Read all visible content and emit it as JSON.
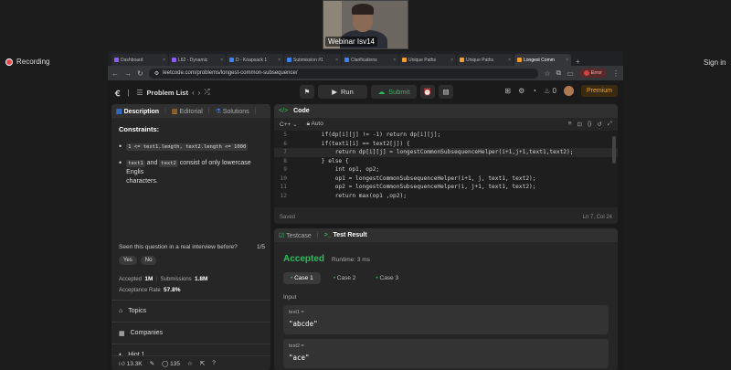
{
  "meeting": {
    "webcam_label": "Webinar Isv14",
    "recording_label": "Recording",
    "signin_label": "Sign in"
  },
  "browser": {
    "tabs": [
      {
        "title": "Dashboard",
        "favicon": "purple"
      },
      {
        "title": "L62 - Dynamic",
        "favicon": "purple"
      },
      {
        "title": "D - Knapsack 1",
        "favicon": "blue"
      },
      {
        "title": "Submission #1",
        "favicon": "blue"
      },
      {
        "title": "Clarifications",
        "favicon": "blue"
      },
      {
        "title": "Unique Paths",
        "favicon": "orange"
      },
      {
        "title": "Unique Paths",
        "favicon": "orange"
      },
      {
        "title": "Longest Comm",
        "favicon": "orange"
      }
    ],
    "url": "leetcode.com/problems/longest-common-subsequence/",
    "error_label": "Error"
  },
  "header": {
    "problem_list": "Problem List",
    "run": "Run",
    "submit": "Submit",
    "streak": "0",
    "premium": "Premium"
  },
  "left_panel": {
    "tabs": [
      "Description",
      "Editorial",
      "Solutions"
    ],
    "constraints_title": "Constraints:",
    "constraint1_code": "1 <= text1.length, text2.length <= 1000",
    "constraint2_code_a": "text1",
    "constraint2_and": " and ",
    "constraint2_code_b": "text2",
    "constraint2_rest": " consist of only lowercase Englis",
    "constraint2_line2": "characters.",
    "interview_q": "Seen this question in a real interview before?",
    "interview_count": "1/5",
    "yes": "Yes",
    "no": "No",
    "accepted_label": "Accepted",
    "accepted_value": "1M",
    "submissions_label": "Submissions",
    "submissions_value": "1.8M",
    "acceptance_label": "Acceptance Rate",
    "acceptance_value": "57.8%",
    "topics": "Topics",
    "companies": "Companies",
    "hint": "Hint 1",
    "likes": "13.3K",
    "comments": "135"
  },
  "code_panel": {
    "title": "Code",
    "language": "C++",
    "mode": "Auto",
    "lines": [
      {
        "n": "5",
        "t": "        if(dp[i][j] != -1) return dp[i][j];"
      },
      {
        "n": "6",
        "t": "        if(text1[i] == text2[j]) {"
      },
      {
        "n": "7",
        "t": "            return dp[i][j] = longestCommonSubsequenceHelper(i+1,j+1,text1,text2);"
      },
      {
        "n": "8",
        "t": "        } else {"
      },
      {
        "n": "9",
        "t": "            int op1, op2;"
      },
      {
        "n": "10",
        "t": "            op1 = longestCommonSubsequenceHelper(i+1, j, text1, text2);"
      },
      {
        "n": "11",
        "t": "            op2 = longestCommonSubsequenceHelper(i, j+1, text1, text2);"
      },
      {
        "n": "12",
        "t": "            return max(op1 ,op2);"
      }
    ],
    "saved": "Saved",
    "cursor": "Ln 7, Col 24"
  },
  "test_panel": {
    "tab_testcase": "Testcase",
    "tab_result": "Test Result",
    "status": "Accepted",
    "runtime": "Runtime: 3 ms",
    "cases": [
      "Case 1",
      "Case 2",
      "Case 3"
    ],
    "input_label": "Input",
    "input1_var": "text1 =",
    "input1_val": "\"abcde\"",
    "input2_var": "text2 =",
    "input2_val": "\"ace\""
  }
}
